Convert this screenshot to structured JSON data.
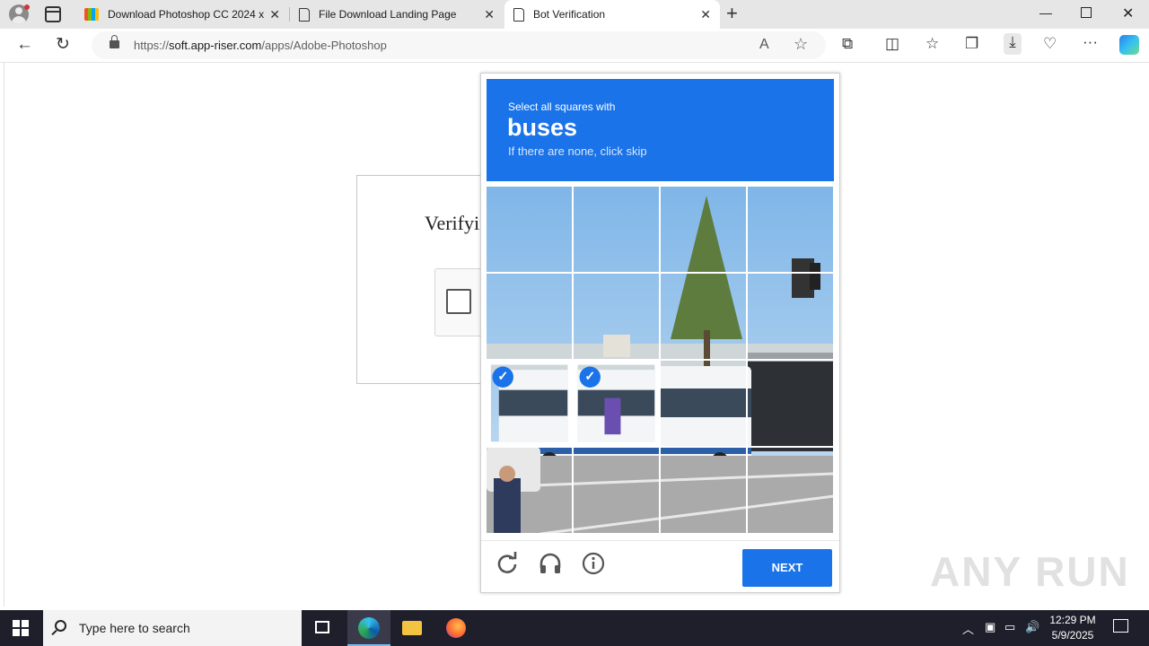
{
  "browser": {
    "tabs": [
      {
        "label": "Download Photoshop CC 2024 x",
        "favicon": "colorful-logo-icon"
      },
      {
        "label": "File Download Landing Page",
        "favicon": "document-icon"
      },
      {
        "label": "Bot Verification",
        "favicon": "document-icon",
        "active": true
      }
    ],
    "url_prefix": "https://",
    "url_host": "soft.app-riser.com",
    "url_path": "/apps/Adobe-Photoshop"
  },
  "page": {
    "verify_title": "Verifying you are human"
  },
  "captcha": {
    "instruction": "Select all squares with",
    "target": "buses",
    "hint": "If there are none, click skip",
    "selected_tiles": [
      8,
      9
    ],
    "next_label": "NEXT",
    "accent_color": "#1a73e8"
  },
  "watermark": "ANY RUN",
  "taskbar": {
    "search_placeholder": "Type here to search",
    "time": "12:29 PM",
    "date": "5/9/2025"
  }
}
